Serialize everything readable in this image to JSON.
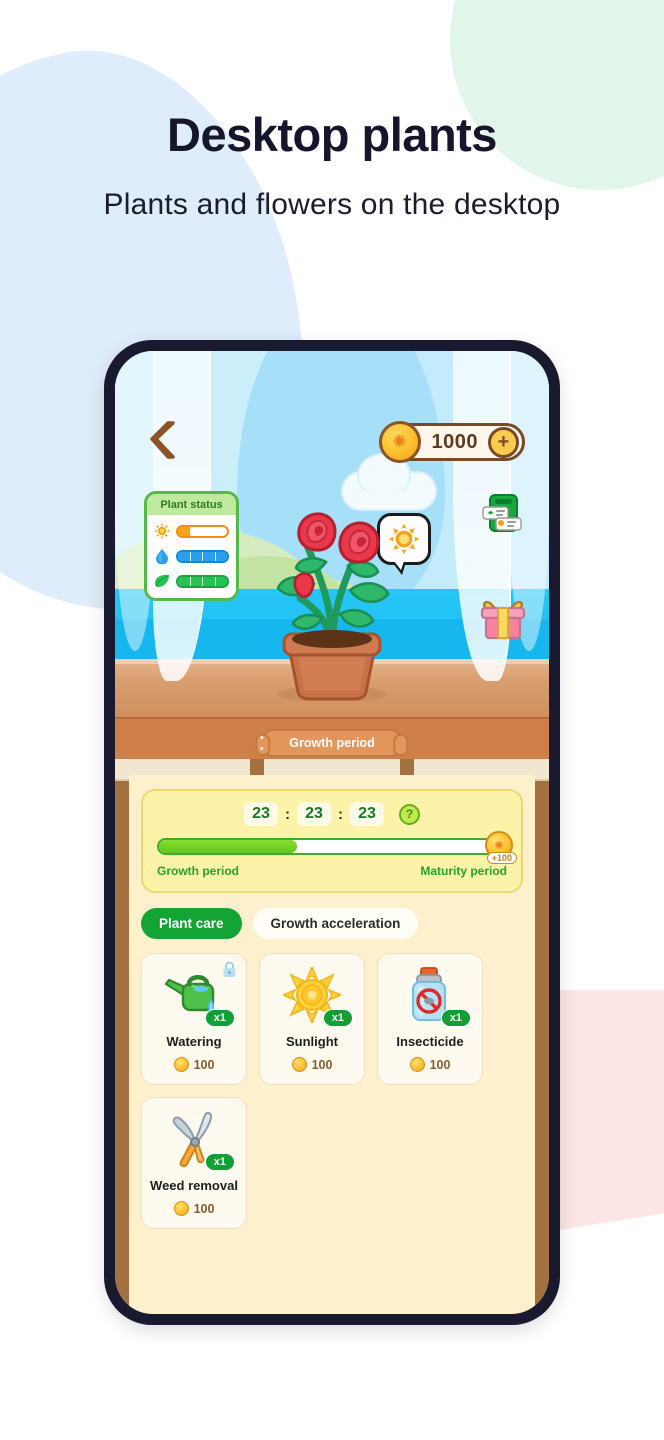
{
  "header": {
    "title": "Desktop plants",
    "subtitle": "Plants and flowers on the desktop"
  },
  "scene": {
    "back_label": "back",
    "coins": {
      "amount": "1000",
      "plus_label": "+"
    },
    "plant_status": {
      "title": "Plant status",
      "bars": [
        {
          "icon": "sun-icon",
          "segments": 4,
          "filled": 1,
          "color": "#fba316"
        },
        {
          "icon": "water-drop-icon",
          "segments": 4,
          "filled": 4,
          "color": "#2aa0ec"
        },
        {
          "icon": "leaf-icon",
          "segments": 4,
          "filled": 4,
          "color": "#26c253"
        }
      ]
    },
    "bubble_icon": "sun-icon",
    "side_icons": [
      {
        "name": "task-list-icon"
      },
      {
        "name": "gift-icon"
      }
    ],
    "stage_ribbon": "Growth period"
  },
  "growth": {
    "timer": {
      "hours": "23",
      "minutes": "23",
      "seconds": "23",
      "separator": ":"
    },
    "help_label": "?",
    "progress_percent": 40,
    "reward_badge": "+100",
    "left_label": "Growth period",
    "right_label": "Maturity period"
  },
  "tabs": [
    {
      "label": "Plant care",
      "active": true
    },
    {
      "label": "Growth acceleration",
      "active": false
    }
  ],
  "items": [
    {
      "name": "Watering",
      "qty": "x1",
      "price": "100",
      "icon": "watering-can-icon",
      "locked": true
    },
    {
      "name": "Sunlight",
      "qty": "x1",
      "price": "100",
      "icon": "sun-icon",
      "locked": false
    },
    {
      "name": "Insecticide",
      "qty": "x1",
      "price": "100",
      "icon": "spray-bottle-icon",
      "locked": false
    },
    {
      "name": "Weed removal",
      "qty": "x1",
      "price": "100",
      "icon": "shears-icon",
      "locked": false
    }
  ],
  "colors": {
    "accent_green": "#14a436",
    "coin_gold": "#fcc134",
    "sky_blue": "#a6e0f8",
    "wood_brown": "#a3703f",
    "panel_cream": "#fdf0cd"
  }
}
